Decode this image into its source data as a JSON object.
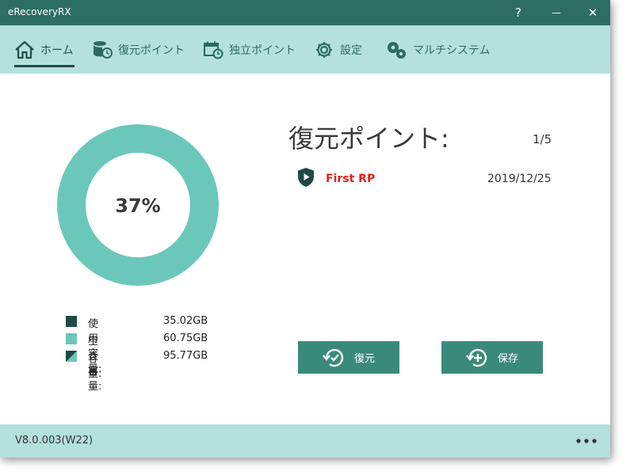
{
  "window": {
    "title": "eRecoveryRX",
    "help_label": "?",
    "minimize_label": "—",
    "close_label": "✕"
  },
  "tabs": [
    {
      "label": "ホーム",
      "icon": "home-icon",
      "active": true
    },
    {
      "label": "復元ポイント",
      "icon": "database-restore-icon",
      "active": false
    },
    {
      "label": "独立ポイント",
      "icon": "calendar-clock-icon",
      "active": false
    },
    {
      "label": "設定",
      "icon": "gear-icon",
      "active": false
    },
    {
      "label": "マルチシステム",
      "icon": "multi-gear-icon",
      "active": false
    }
  ],
  "disk": {
    "percent_label": "37%",
    "used_fraction": 0.37,
    "legend": [
      {
        "label": "使用容量:",
        "value": "35.02GB",
        "color": "#1f4a44"
      },
      {
        "label": "空き容量:",
        "value": "60.75GB",
        "color": "#6cc7bb"
      },
      {
        "label": "容量:",
        "value": "95.77GB",
        "color": "split"
      }
    ]
  },
  "restore_points": {
    "title": "復元ポイント:",
    "count": "1/5",
    "items": [
      {
        "name": "First RP",
        "date": "2019/12/25",
        "icon": "shield-play-icon"
      }
    ]
  },
  "actions": {
    "restore_label": "復元",
    "save_label": "保存"
  },
  "footer": {
    "version": "V8.0.003(W22)",
    "more_icon": "more-dots-icon"
  },
  "colors": {
    "titlebar": "#2d6e63",
    "tabbar": "#b5e1dc",
    "used": "#1f4a44",
    "free": "#6cc7bb",
    "button": "#3a8a7c",
    "rp_name": "#e0231b"
  }
}
